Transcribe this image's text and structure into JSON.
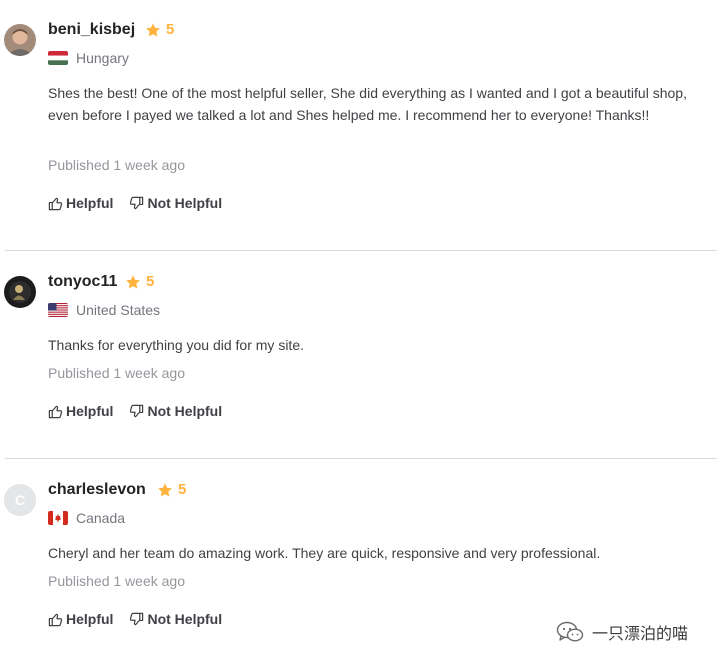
{
  "reviews": [
    {
      "username": "beni_kisbej",
      "rating": "5",
      "country": "Hungary",
      "text": "Shes the best! One of the most helpful seller, She did everything as I wanted and I got a beautiful shop, even before I payed we talked a lot and Shes helped me. I recommend her to everyone! Thanks!!",
      "published": "Published 1 week ago",
      "helpful_label": "Helpful",
      "not_helpful_label": "Not Helpful"
    },
    {
      "username": "tonyoc11",
      "rating": "5",
      "country": "United States",
      "text": "Thanks for everything you did for my site.",
      "published": "Published 1 week ago",
      "helpful_label": "Helpful",
      "not_helpful_label": "Not Helpful"
    },
    {
      "username": "charleslevon",
      "avatar_initial": "C",
      "rating": "5",
      "country": "Canada",
      "text": "Cheryl and her team do amazing work. They are quick, responsive and very professional.",
      "published": "Published 1 week ago",
      "helpful_label": "Helpful",
      "not_helpful_label": "Not Helpful"
    }
  ],
  "watermark": {
    "text": "一只漂泊的喵"
  },
  "colors": {
    "star": "#ffb33e",
    "divider": "#dadbdd"
  },
  "icons": {
    "star": "star-icon",
    "helpful": "thumbs-up-icon",
    "not_helpful": "thumbs-down-icon",
    "watermark": "wechat-icon"
  }
}
